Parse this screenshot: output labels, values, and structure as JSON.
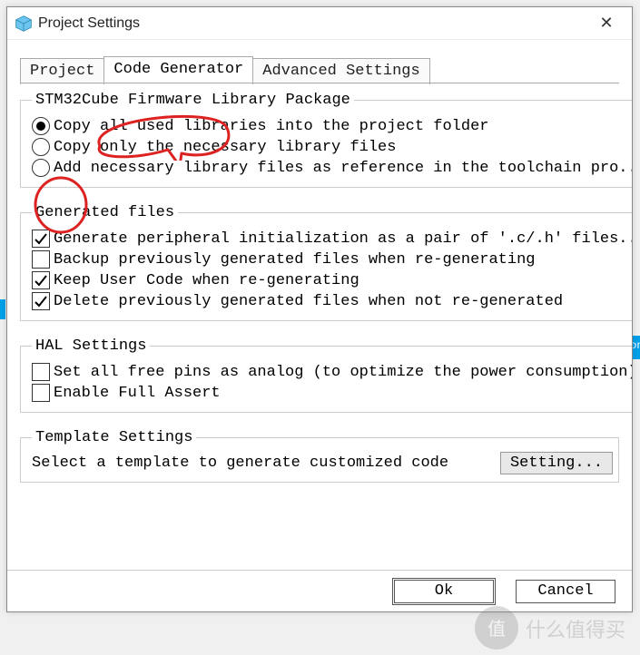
{
  "window": {
    "title": "Project Settings",
    "close_glyph": "✕"
  },
  "tabs": {
    "project": "Project",
    "code_generator": "Code Generator",
    "advanced": "Advanced Settings",
    "active_index": 1
  },
  "firmware": {
    "legend": "STM32Cube Firmware Library Package",
    "options": [
      {
        "label": "Copy all used libraries into the project folder",
        "selected": true
      },
      {
        "label": "Copy only the necessary library files",
        "selected": false
      },
      {
        "label": "Add necessary library files as reference in the toolchain pro...",
        "selected": false
      }
    ]
  },
  "generated": {
    "legend": "Generated files",
    "options": [
      {
        "label": "Generate peripheral initialization as a pair of '.c/.h' files...",
        "checked": true
      },
      {
        "label": "Backup previously generated files when re-generating",
        "checked": false
      },
      {
        "label": "Keep User Code when re-generating",
        "checked": true
      },
      {
        "label": "Delete previously generated files when not re-generated",
        "checked": true
      }
    ]
  },
  "hal": {
    "legend": "HAL Settings",
    "options": [
      {
        "label": "Set all free pins as analog (to optimize the power consumption)",
        "checked": false
      },
      {
        "label": "Enable Full Assert",
        "checked": false
      }
    ]
  },
  "template": {
    "legend": "Template Settings",
    "text": "Select a template to generate customized code",
    "button": "Setting..."
  },
  "footer": {
    "ok": "Ok",
    "cancel": "Cancel"
  },
  "bg_accent_right_text": "Con",
  "watermark_text": "什么值得买"
}
